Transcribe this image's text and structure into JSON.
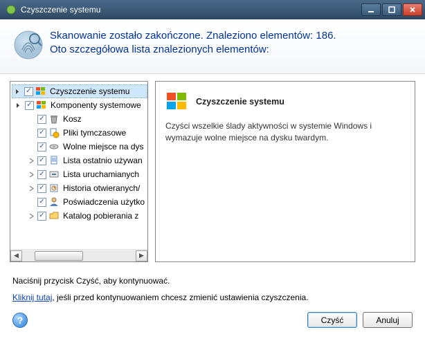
{
  "window": {
    "title": "Czyszczenie systemu"
  },
  "header": {
    "line1": "Skanowanie zostało zakończone. Znaleziono elementów: 186.",
    "line2": "Oto szczegółowa lista znalezionych elementów:"
  },
  "tree": {
    "root": {
      "label": "Czyszczenie systemu",
      "checked": true,
      "expanded": true
    },
    "group": {
      "label": "Komponenty systemowe",
      "checked": true,
      "expanded": true
    },
    "items": [
      {
        "label": "Kosz",
        "checked": true,
        "icon": "trash",
        "expandable": false
      },
      {
        "label": "Pliki tymczasowe",
        "checked": true,
        "icon": "temp",
        "expandable": false
      },
      {
        "label": "Wolne miejsce na dys",
        "checked": true,
        "icon": "disk",
        "expandable": false
      },
      {
        "label": "Lista ostatnio używan",
        "checked": true,
        "icon": "doc",
        "expandable": true
      },
      {
        "label": "Lista uruchamianych",
        "checked": true,
        "icon": "run",
        "expandable": true
      },
      {
        "label": "Historia otwieranych/",
        "checked": true,
        "icon": "history",
        "expandable": true
      },
      {
        "label": "Poświadczenia użytko",
        "checked": true,
        "icon": "user",
        "expandable": false
      },
      {
        "label": "Katalog pobierania z",
        "checked": true,
        "icon": "folder",
        "expandable": true
      }
    ]
  },
  "detail": {
    "title": "Czyszczenie systemu",
    "body": "Czyści wszelkie ślady aktywności w systemie Windows i wymazuje wolne miejsce na dysku twardym."
  },
  "footer": {
    "text1": "Naciśnij przycisk Czyść, aby kontynuować.",
    "link_text": "Kliknij tutaj",
    "text2": ", jeśli przed kontynuowaniem chcesz zmienić ustawienia czyszczenia.",
    "btn_primary": "Czyść",
    "btn_cancel": "Anuluj"
  }
}
